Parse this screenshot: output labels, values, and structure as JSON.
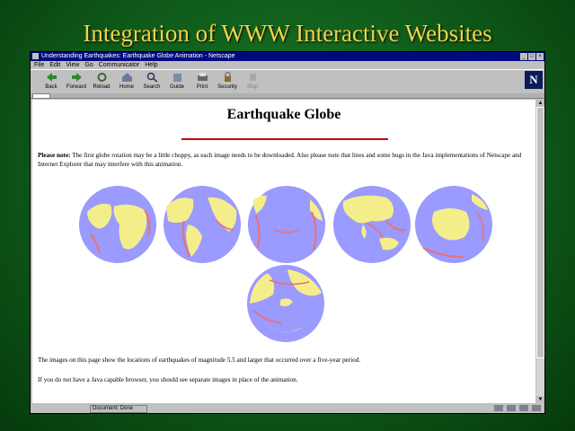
{
  "slide": {
    "title": "Integration of WWW Interactive Websites"
  },
  "window": {
    "title": "Understanding Earthquakes: Earthquake Globe Animation - Netscape",
    "menu": [
      "File",
      "Edit",
      "View",
      "Go",
      "Communicator",
      "Help"
    ],
    "toolbar": [
      "Back",
      "Forward",
      "Reload",
      "Home",
      "Search",
      "Guide",
      "Print",
      "Security",
      "Stop"
    ],
    "status": "Document: Done"
  },
  "page": {
    "heading": "Earthquake Globe",
    "note_bold": "Please note:",
    "note": " The first globe rotation may be a little choppy, as each image needs to be downloaded. Also please note that lines and some bugs in the Java implementations of Netscape and Internet Explorer that may interfere with this animation.",
    "caption": "The images on this page show the locations of earthquakes of magnitude 5.5 and larger that occurred over a five-year period.",
    "fallback": "If you do not have a Java capable browser, you should see separate images in place of the animation."
  },
  "colors": {
    "ocean": "#9a9aff",
    "land": "#f4ee8a",
    "quake": "#ee6f6f",
    "title": "#f0d34a"
  }
}
